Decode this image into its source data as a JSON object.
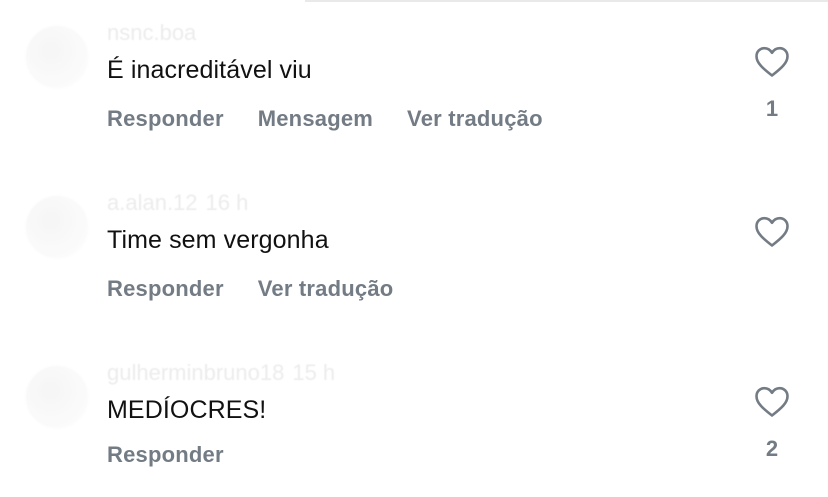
{
  "comments": [
    {
      "username": "nsnc.boa",
      "time": "",
      "text": "É inacreditável viu",
      "actions": [
        "Responder",
        "Mensagem",
        "Ver tradução"
      ],
      "likes": "1",
      "like_icon": "heart-outline"
    },
    {
      "username": "a.alan.12",
      "time": "16 h",
      "text": "Time sem vergonha",
      "actions": [
        "Responder",
        "Ver tradução"
      ],
      "likes": "",
      "like_icon": "heart-outline"
    },
    {
      "username": "gulherminbruno18",
      "time": "15 h",
      "text": "MEDÍOCRES!",
      "actions": [
        "Responder"
      ],
      "likes": "2",
      "like_icon": "heart-outline"
    }
  ],
  "colors": {
    "text": "#111111",
    "secondary": "#737b84",
    "background": "#ffffff"
  }
}
